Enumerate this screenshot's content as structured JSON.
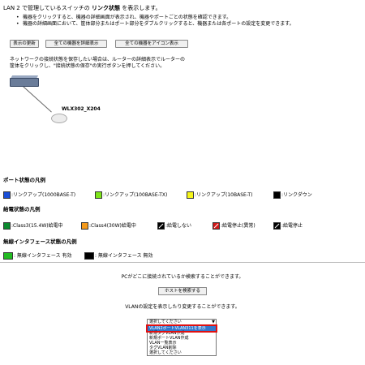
{
  "header": {
    "title_prefix": "LAN 2 で管理しているスイッチの ",
    "title_bold": "リンク状態",
    "title_suffix": " を表示します。",
    "bullets": [
      "機器をクリックすると、機器の詳細画面が表示され、機器やポートごとの状態を確認できます。",
      "機器の詳細画面において、筐体部分またはポート部分をダブルクリックすると、機器または各ポートの設定を変更できます。"
    ]
  },
  "toolbar": {
    "refresh": "表示の更新",
    "show_all_detail": "全ての機器を詳細表示",
    "show_all_icon": "全ての機器をアイコン表示"
  },
  "note": "ネットワークの接続状態を保存したい場合は、ルーターの詳細表示でルーターの\n筐体をクリックし、\"接続状態の保存\"の実行ボタンを押してください。",
  "topology": {
    "device_label": "WLX302_X204"
  },
  "port_legend": {
    "title": "ポート状態の凡例",
    "items": [
      {
        "color": "#1a4fd8",
        "label": ":リンクアップ(1000BASE-T)"
      },
      {
        "color": "#7ee61a",
        "label": ":リンクアップ(100BASE-TX)"
      },
      {
        "color": "#f5f51a",
        "label": ":リンクアップ(10BASE-T)"
      },
      {
        "color": "#000000",
        "label": ":リンクダウン"
      }
    ]
  },
  "power_legend": {
    "title": "給電状態の凡例",
    "items": [
      {
        "color": "#0b8a2e",
        "label": ":Class3(15.4W)給電中"
      },
      {
        "color": "#f59a1a",
        "label": ":Class4(30W)給電中"
      },
      {
        "color": "#000000",
        "label": ":給電しない"
      },
      {
        "color": "#d01818",
        "label": ":給電停止(異常)"
      },
      {
        "color": "#000000",
        "label": ":給電停止"
      }
    ]
  },
  "wireless_legend": {
    "title": "無線インタフェース状態の凡例",
    "items": [
      {
        "color": "#22bb22",
        "label": ": 無線インタフェース 有効"
      },
      {
        "color": "#000000",
        "label": ": 無線インタフェース 無効"
      }
    ]
  },
  "search": {
    "text": "PCがどこに接続されているか検索することができます。",
    "button": "ホストを検索する"
  },
  "vlan": {
    "text": "VLANの設定を表示したり変更することができます。",
    "selected": "選択してください",
    "options": [
      "VLAN2ポートVLAN311を表示",
      "新規タグVLAN作成",
      "新規ポートVLAN作成",
      "VLAN一覧表示",
      "タグVLAN削除",
      "選択してください"
    ]
  }
}
